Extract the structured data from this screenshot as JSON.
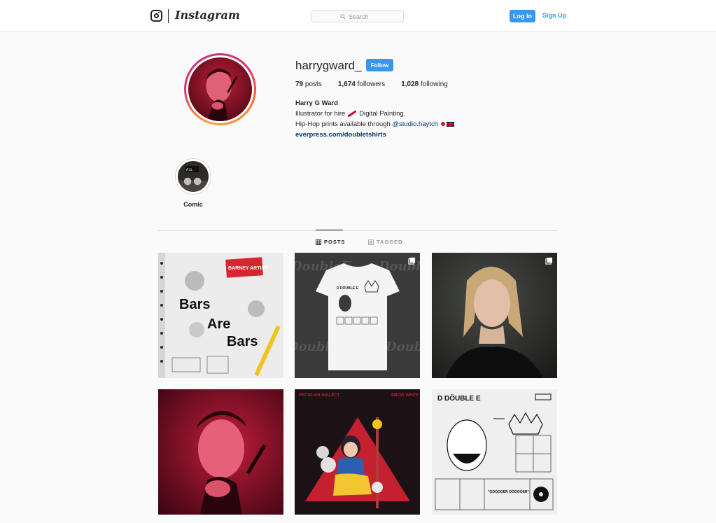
{
  "nav": {
    "brand": "Instagram",
    "search_placeholder": "Search",
    "login_label": "Log In",
    "signup_label": "Sign Up"
  },
  "profile": {
    "username": "harrygward_",
    "follow_label": "Follow",
    "stats": {
      "posts_count": "79",
      "posts_label": "posts",
      "followers_count": "1,674",
      "followers_label": "followers",
      "following_count": "1,028",
      "following_label": "following"
    },
    "bio": {
      "full_name": "Harry G Ward",
      "line1_text": "Illustrator for hire",
      "line1_suffix": "Digital Painting.",
      "line2_text": "Hip-Hop prints available through",
      "line2_mention": "@studio.haytch",
      "website": "everpress.com/doubletshirts"
    }
  },
  "highlights": [
    {
      "label": "Comic"
    }
  ],
  "tabs": {
    "posts_label": "POSTS",
    "tagged_label": "TAGGED"
  },
  "posts": [
    {
      "title_lines": [
        "Bars",
        "Are",
        "Bars"
      ],
      "badge": "BARNEY ARTIST"
    },
    {
      "shirt_text": "D DÖUBLE E",
      "bg_text": "DoubleE",
      "multi": true
    },
    {
      "multi": true
    },
    {},
    {
      "left_text": "PECULIAR DIALECT",
      "right_text": "SNOW WHITE"
    },
    {
      "title": "D DÖUBLE E",
      "quote": "\"OOOOOER OOOOOER\""
    }
  ],
  "colors": {
    "accent_blue": "#3897f0",
    "link_navy": "#003569",
    "border": "#dbdbdb",
    "background": "#fafafa"
  }
}
